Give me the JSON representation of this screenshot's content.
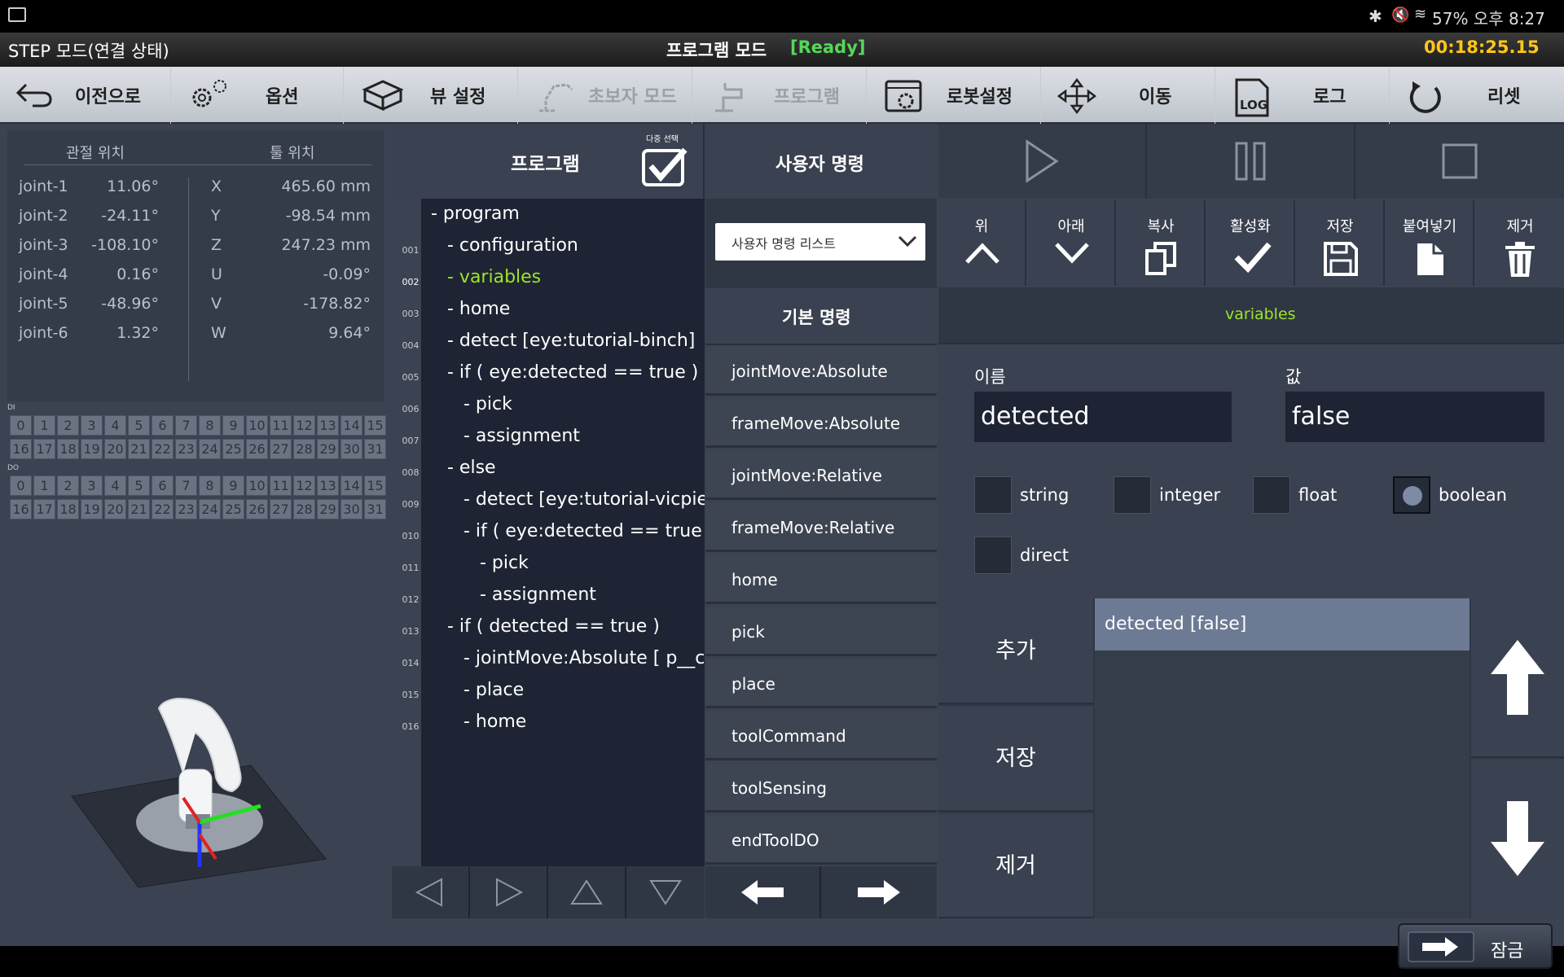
{
  "statusbar": {
    "right": "57% 오후 8:27"
  },
  "titlebar": {
    "mode": "STEP 모드(연결 상태)",
    "program_mode": "프로그램 모드",
    "ready": "[Ready]",
    "timer": "00:18:25.15"
  },
  "toolbar": {
    "back": "이전으로",
    "options": "옵션",
    "view": "뷰 설정",
    "beginner": "초보자 모드",
    "program": "프로그램",
    "robot": "로봇설정",
    "move": "이동",
    "log": "로그",
    "reset": "리셋"
  },
  "position": {
    "joint_header": "관절 위치",
    "tool_header": "툴 위치",
    "joints": [
      {
        "name": "joint-1",
        "value": "11.06°",
        "axis": "X",
        "tool": "465.60 mm"
      },
      {
        "name": "joint-2",
        "value": "-24.11°",
        "axis": "Y",
        "tool": "-98.54 mm"
      },
      {
        "name": "joint-3",
        "value": "-108.10°",
        "axis": "Z",
        "tool": "247.23 mm"
      },
      {
        "name": "joint-4",
        "value": "0.16°",
        "axis": "U",
        "tool": "-0.09°"
      },
      {
        "name": "joint-5",
        "value": "-48.96°",
        "axis": "V",
        "tool": "-178.82°"
      },
      {
        "name": "joint-6",
        "value": "1.32°",
        "axis": "W",
        "tool": "9.64°"
      }
    ]
  },
  "io": {
    "di_label": "DI",
    "do_label": "DO"
  },
  "program": {
    "title": "프로그램",
    "multi_select": "다중 선택",
    "lines": [
      {
        "num": "",
        "text": "- program",
        "indent": 0,
        "active": false
      },
      {
        "num": "001",
        "text": "- configuration",
        "indent": 1,
        "active": false
      },
      {
        "num": "002",
        "text": "- variables",
        "indent": 1,
        "active": true
      },
      {
        "num": "003",
        "text": "- home",
        "indent": 1,
        "active": false
      },
      {
        "num": "004",
        "text": "- detect [eye:tutorial-binch]",
        "indent": 1,
        "active": false
      },
      {
        "num": "005",
        "text": "- if ( eye:detected == true )",
        "indent": 1,
        "active": false
      },
      {
        "num": "006",
        "text": "- pick",
        "indent": 2,
        "active": false
      },
      {
        "num": "007",
        "text": "- assignment",
        "indent": 2,
        "active": false
      },
      {
        "num": "008",
        "text": "- else",
        "indent": 1,
        "active": false
      },
      {
        "num": "009",
        "text": "- detect [eye:tutorial-vicpie]",
        "indent": 2,
        "active": false
      },
      {
        "num": "010",
        "text": "- if ( eye:detected == true )",
        "indent": 2,
        "active": false
      },
      {
        "num": "011",
        "text": "- pick",
        "indent": 3,
        "active": false
      },
      {
        "num": "012",
        "text": "- assignment",
        "indent": 3,
        "active": false
      },
      {
        "num": "013",
        "text": "- if ( detected == true )",
        "indent": 1,
        "active": false
      },
      {
        "num": "014",
        "text": "- jointMove:Absolute [ p__copy",
        "indent": 2,
        "active": false
      },
      {
        "num": "015",
        "text": "- place",
        "indent": 2,
        "active": false
      },
      {
        "num": "016",
        "text": "- home",
        "indent": 2,
        "active": false
      }
    ]
  },
  "user_cmd": {
    "title": "사용자 명령",
    "dropdown": "사용자 명령 리스트",
    "basic": "기본 명령",
    "commands": [
      "jointMove:Absolute",
      "frameMove:Absolute",
      "jointMove:Relative",
      "frameMove:Relative",
      "home",
      "pick",
      "place",
      "toolCommand",
      "toolSensing",
      "endToolDO"
    ]
  },
  "edit": {
    "up": "위",
    "down": "아래",
    "copy": "복사",
    "activate": "활성화",
    "save": "저장",
    "paste": "붙여넣기",
    "delete": "제거"
  },
  "variables": {
    "title": "variables",
    "name_label": "이름",
    "value_label": "값",
    "name_value": "detected",
    "value_value": "false",
    "types": [
      "string",
      "integer",
      "float",
      "boolean",
      "direct"
    ],
    "selected_type": "boolean",
    "list_item": "detected [false]",
    "add": "추가",
    "save": "저장",
    "remove": "제거"
  },
  "lock": "잠금",
  "colors": {
    "active": "#9be52a",
    "ready": "#54d957",
    "timer": "#ffc61a"
  }
}
